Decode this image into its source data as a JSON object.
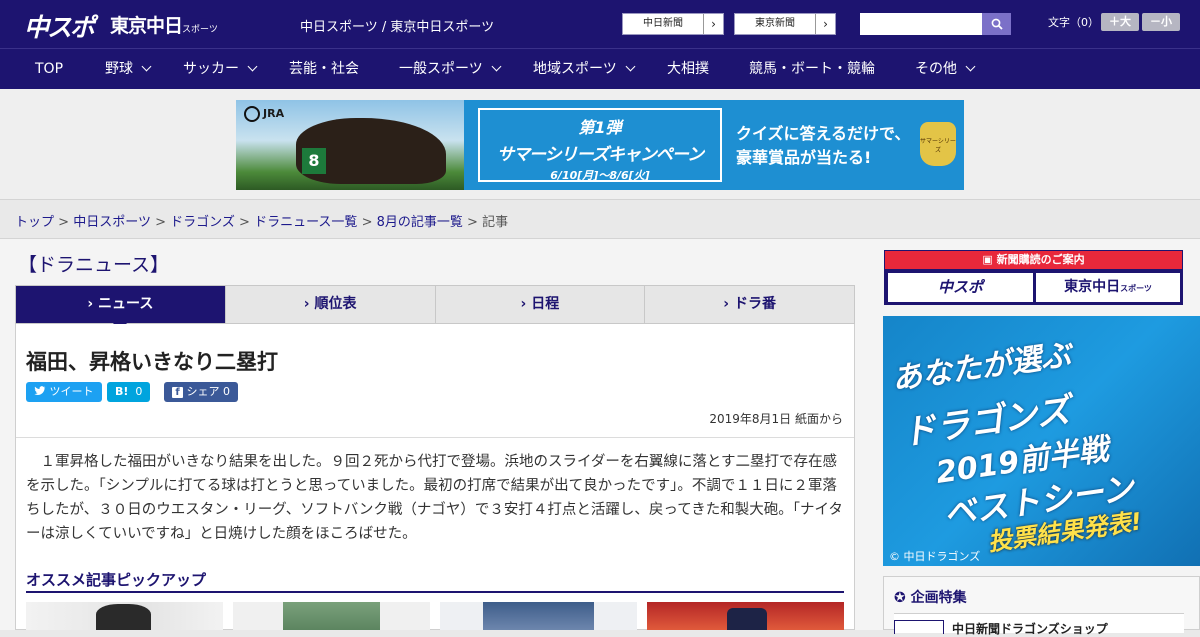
{
  "header": {
    "logo_main": "中スポ",
    "logo_tokyo": "東京中日",
    "logo_tokyo_sub": "スポーツ",
    "tagline": "中日スポーツ / 東京中日スポーツ",
    "site_links": [
      "中日新聞",
      "東京新聞"
    ],
    "search_placeholder": "",
    "font_size_label": "文字（0）",
    "font_bigger": "＋大",
    "font_smaller": "－小"
  },
  "nav": {
    "items": [
      {
        "label": "TOP",
        "has_menu": false
      },
      {
        "label": "野球",
        "has_menu": true
      },
      {
        "label": "サッカー",
        "has_menu": true
      },
      {
        "label": "芸能・社会",
        "has_menu": false
      },
      {
        "label": "一般スポーツ",
        "has_menu": true
      },
      {
        "label": "地域スポーツ",
        "has_menu": true
      },
      {
        "label": "大相撲",
        "has_menu": false
      },
      {
        "label": "競馬・ボート・競輪",
        "has_menu": false
      },
      {
        "label": "その他",
        "has_menu": true
      }
    ]
  },
  "banner": {
    "brand": "JRA",
    "horse_number": "8",
    "campaign_line1": "第1弾",
    "campaign_line2": "サマーシリーズキャンペーン",
    "campaign_dates": "6/10[月]～8/6[火]",
    "quiz_line1": "クイズに答えるだけで、",
    "quiz_line2": "豪華賞品が当たる!",
    "trophy_text": "サマーシリーズ",
    "accent_color": "#1e8fd2"
  },
  "breadcrumb": {
    "links": [
      "トップ",
      "中日スポーツ",
      "ドラゴンズ",
      "ドラニュース一覧",
      "8月の記事一覧"
    ],
    "separator": ">",
    "current": "記事"
  },
  "section_title": "【ドラニュース】",
  "tabs": [
    {
      "label": "ニュース",
      "active": true
    },
    {
      "label": "順位表",
      "active": false
    },
    {
      "label": "日程",
      "active": false
    },
    {
      "label": "ドラ番",
      "active": false
    }
  ],
  "article": {
    "headline": "福田、昇格いきなり二塁打",
    "share": {
      "tweet": "ツイート",
      "hatena_label": "B!",
      "hatena_count": "0",
      "facebook_label": "シェア",
      "facebook_count": "0"
    },
    "date": "2019年8月1日 紙面から",
    "body": "１軍昇格した福田がいきなり結果を出した。９回２死から代打で登場。浜地のスライダーを右翼線に落とす二塁打で存在感を示した。「シンプルに打てる球は打とうと思っていました。最初の打席で結果が出て良かったです」。不調で１１日に２軍落ちしたが、３０日のウエスタン・リーグ、ソフトバンク戦（ナゴヤ）で３安打４打点と活躍し、戻ってきた和製大砲。「ナイターは涼しくていいですね」と日焼けした顔をほころばせた。"
  },
  "pickup": {
    "title": "オススメ記事ピックアップ",
    "thumbs": [
      "thumb-1",
      "thumb-2",
      "thumb-3",
      "thumb-4"
    ]
  },
  "sidebar": {
    "subscribe_header": "新聞購読のご案内",
    "subscribe_links": [
      "中スポ",
      "東京中日"
    ],
    "subscribe_sub": "スポーツ",
    "ad": {
      "line1": "あなたが選ぶ",
      "line2": "ドラゴンズ",
      "line3": "2019前半戦",
      "line4": "ベストシーン",
      "line5": "投票結果発表!",
      "copyright": "© 中日ドラゴンズ"
    },
    "feature_title": "企画特集",
    "feature_item": "中日新聞ドラゴンズショップ"
  },
  "colors": {
    "brand": "#1d1470",
    "twitter": "#1da1f2",
    "hatena": "#00a4de",
    "facebook": "#3b5998",
    "sidebar_red": "#e8283b"
  }
}
